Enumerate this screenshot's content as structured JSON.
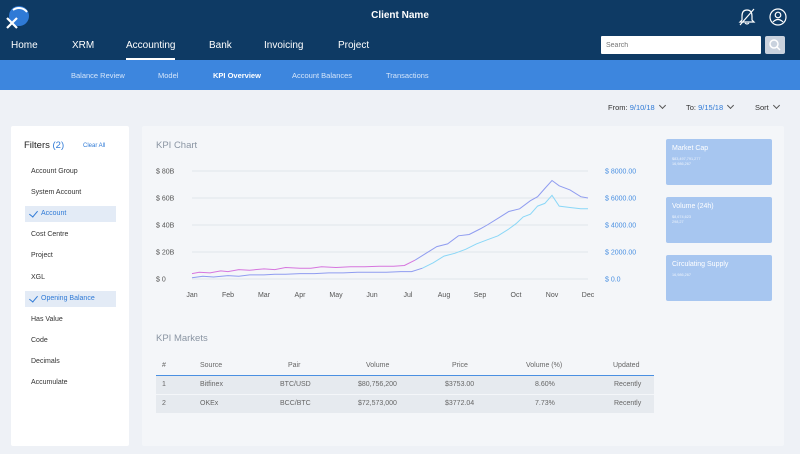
{
  "header": {
    "client_name": "Client Name",
    "nav": [
      "Home",
      "XRM",
      "Accounting",
      "Bank",
      "Invoicing",
      "Project"
    ],
    "active_nav": "Accounting",
    "search_placeholder": "Search",
    "icons": [
      "close-icon",
      "bell-icon",
      "user-icon",
      "search-icon"
    ]
  },
  "subnav": {
    "items": [
      "Balance Review",
      "Model",
      "KPI Overview",
      "Account Balances",
      "Transactions"
    ],
    "active": "KPI Overview"
  },
  "toolbar": {
    "from_label": "From:",
    "from_value": "9/10/18",
    "to_label": "To:",
    "to_value": "9/15/18",
    "sort_label": "Sort"
  },
  "filters": {
    "title": "Filters",
    "count": "(2)",
    "clear_label": "Clear All",
    "items": [
      {
        "label": "Account Group",
        "checked": false
      },
      {
        "label": "System Account",
        "checked": false
      },
      {
        "label": "Account",
        "checked": true
      },
      {
        "label": "Cost Centre",
        "checked": false
      },
      {
        "label": "Project",
        "checked": false
      },
      {
        "label": "XGL",
        "checked": false
      },
      {
        "label": "Opening Balance",
        "checked": true
      },
      {
        "label": "Has Value",
        "checked": false
      },
      {
        "label": "Code",
        "checked": false
      },
      {
        "label": "Decimals",
        "checked": false
      },
      {
        "label": "Accumulate",
        "checked": false
      }
    ]
  },
  "kpi_chart": {
    "title": "KPI Chart"
  },
  "chart_data": {
    "type": "line",
    "title": "KPI Chart",
    "categories": [
      "Jan",
      "Feb",
      "Mar",
      "Apr",
      "May",
      "Jun",
      "Jul",
      "Aug",
      "Sep",
      "Oct",
      "Nov",
      "Dec"
    ],
    "y_left_ticks": [
      "$ 0",
      "$ 20B",
      "$ 40B",
      "$ 60B",
      "$ 80B"
    ],
    "y_right_ticks": [
      "$ 0.0",
      "$ 2000.00",
      "$ 4000.00",
      "$ 6000.00",
      "$ 8000.00"
    ],
    "ylim": [
      0,
      80
    ],
    "grid": true,
    "colors": {
      "series1": "#d675de",
      "series2": "#8f9cf0",
      "series3": "#8ad7f7"
    },
    "series": [
      {
        "x": [
          0.0,
          0.2,
          0.5,
          0.8,
          1.0,
          1.3,
          1.6,
          2.0,
          2.3,
          2.6,
          3.0,
          3.3,
          3.6,
          4.0,
          4.4,
          4.8,
          5.2,
          5.6,
          5.9,
          6.2,
          6.5,
          6.8,
          7.1,
          7.4,
          7.7,
          8.0,
          8.2,
          8.5,
          8.8,
          9.1,
          9.4,
          9.6,
          9.8,
          10.0,
          10.2,
          10.5,
          10.8,
          11.0
        ],
        "values": [
          4,
          5,
          4.5,
          6,
          5.5,
          7,
          6.5,
          7.5,
          7,
          8.5,
          8,
          8,
          9,
          8.5,
          9,
          9,
          9.5,
          9.5,
          10,
          14,
          19,
          24,
          26,
          32,
          33,
          37,
          40,
          45,
          50,
          52,
          58,
          61,
          67,
          73,
          69,
          66,
          61,
          60
        ]
      },
      {
        "x": [
          0.0,
          0.3,
          0.6,
          1.0,
          1.3,
          1.6,
          2.0,
          2.3,
          2.6,
          3.0,
          3.4,
          3.8,
          4.2,
          4.6,
          5.0,
          5.4,
          5.8,
          6.1,
          6.4,
          6.7,
          7.0,
          7.3,
          7.6,
          7.9,
          8.2,
          8.5,
          8.8,
          9.0,
          9.2,
          9.4,
          9.6,
          9.8,
          10.0,
          10.2,
          10.5,
          10.8,
          11.0
        ],
        "values": [
          1,
          2,
          1.5,
          2.5,
          2,
          3,
          3,
          3.5,
          3.5,
          4,
          4,
          4.5,
          4.5,
          5,
          5,
          5,
          5.5,
          5.5,
          8,
          12,
          17,
          19,
          22,
          26,
          29,
          32,
          37,
          41,
          46,
          48,
          54,
          56,
          62,
          54,
          53,
          52,
          52
        ]
      }
    ]
  },
  "kpi_cards": [
    {
      "title": "Market Cap",
      "sub": [
        "$83,497,791,277",
        "16,986,267"
      ]
    },
    {
      "title": "Volume (24h)",
      "sub": [
        "$8,674,623",
        "298,27"
      ]
    },
    {
      "title": "Circulating Supply",
      "sub": [
        "16,986,267"
      ]
    }
  ],
  "kpi_markets": {
    "title": "KPI Markets",
    "columns": [
      "#",
      "Source",
      "Pair",
      "Volume",
      "Price",
      "Volume (%)",
      "Updated"
    ],
    "rows": [
      [
        "1",
        "Bitfinex",
        "BTC/USD",
        "$80,756,200",
        "$3753.00",
        "8.60%",
        "Recently"
      ],
      [
        "2",
        "OKEx",
        "BCC/BTC",
        "$72,573,000",
        "$3772.04",
        "7.73%",
        "Recently"
      ]
    ]
  }
}
